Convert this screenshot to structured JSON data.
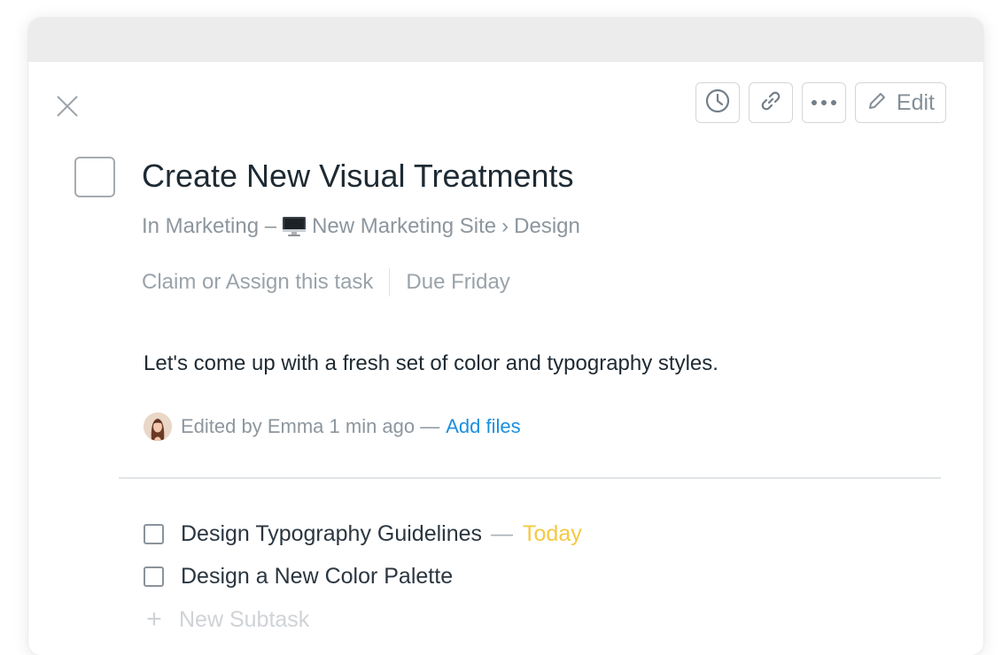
{
  "toolbar": {
    "icons": [
      "clock-icon",
      "link-icon",
      "more-icon",
      "pencil-icon"
    ],
    "edit_label": "Edit"
  },
  "task": {
    "title": "Create New Visual Treatments",
    "breadcrumb": {
      "prefix": "In Marketing –",
      "project_icon": "monitor-emoji",
      "project": "New Marketing Site",
      "separator": "›",
      "section": "Design"
    },
    "assign_label": "Claim or Assign this task",
    "due_label": "Due Friday",
    "description": "Let's come up with a fresh set of color and typography styles.",
    "activity": {
      "text": "Edited by Emma 1 min ago —",
      "add_files": "Add files"
    }
  },
  "subtasks": [
    {
      "name": "Design Typography Guidelines",
      "dash": "—",
      "due": "Today"
    },
    {
      "name": "Design a New Color Palette",
      "dash": "",
      "due": ""
    }
  ],
  "new_subtask": {
    "icon": "+",
    "label": "New Subtask"
  },
  "colors": {
    "accent_link": "#1a8fe0",
    "due_today": "#f5c842",
    "titlebar": "#ececec"
  }
}
